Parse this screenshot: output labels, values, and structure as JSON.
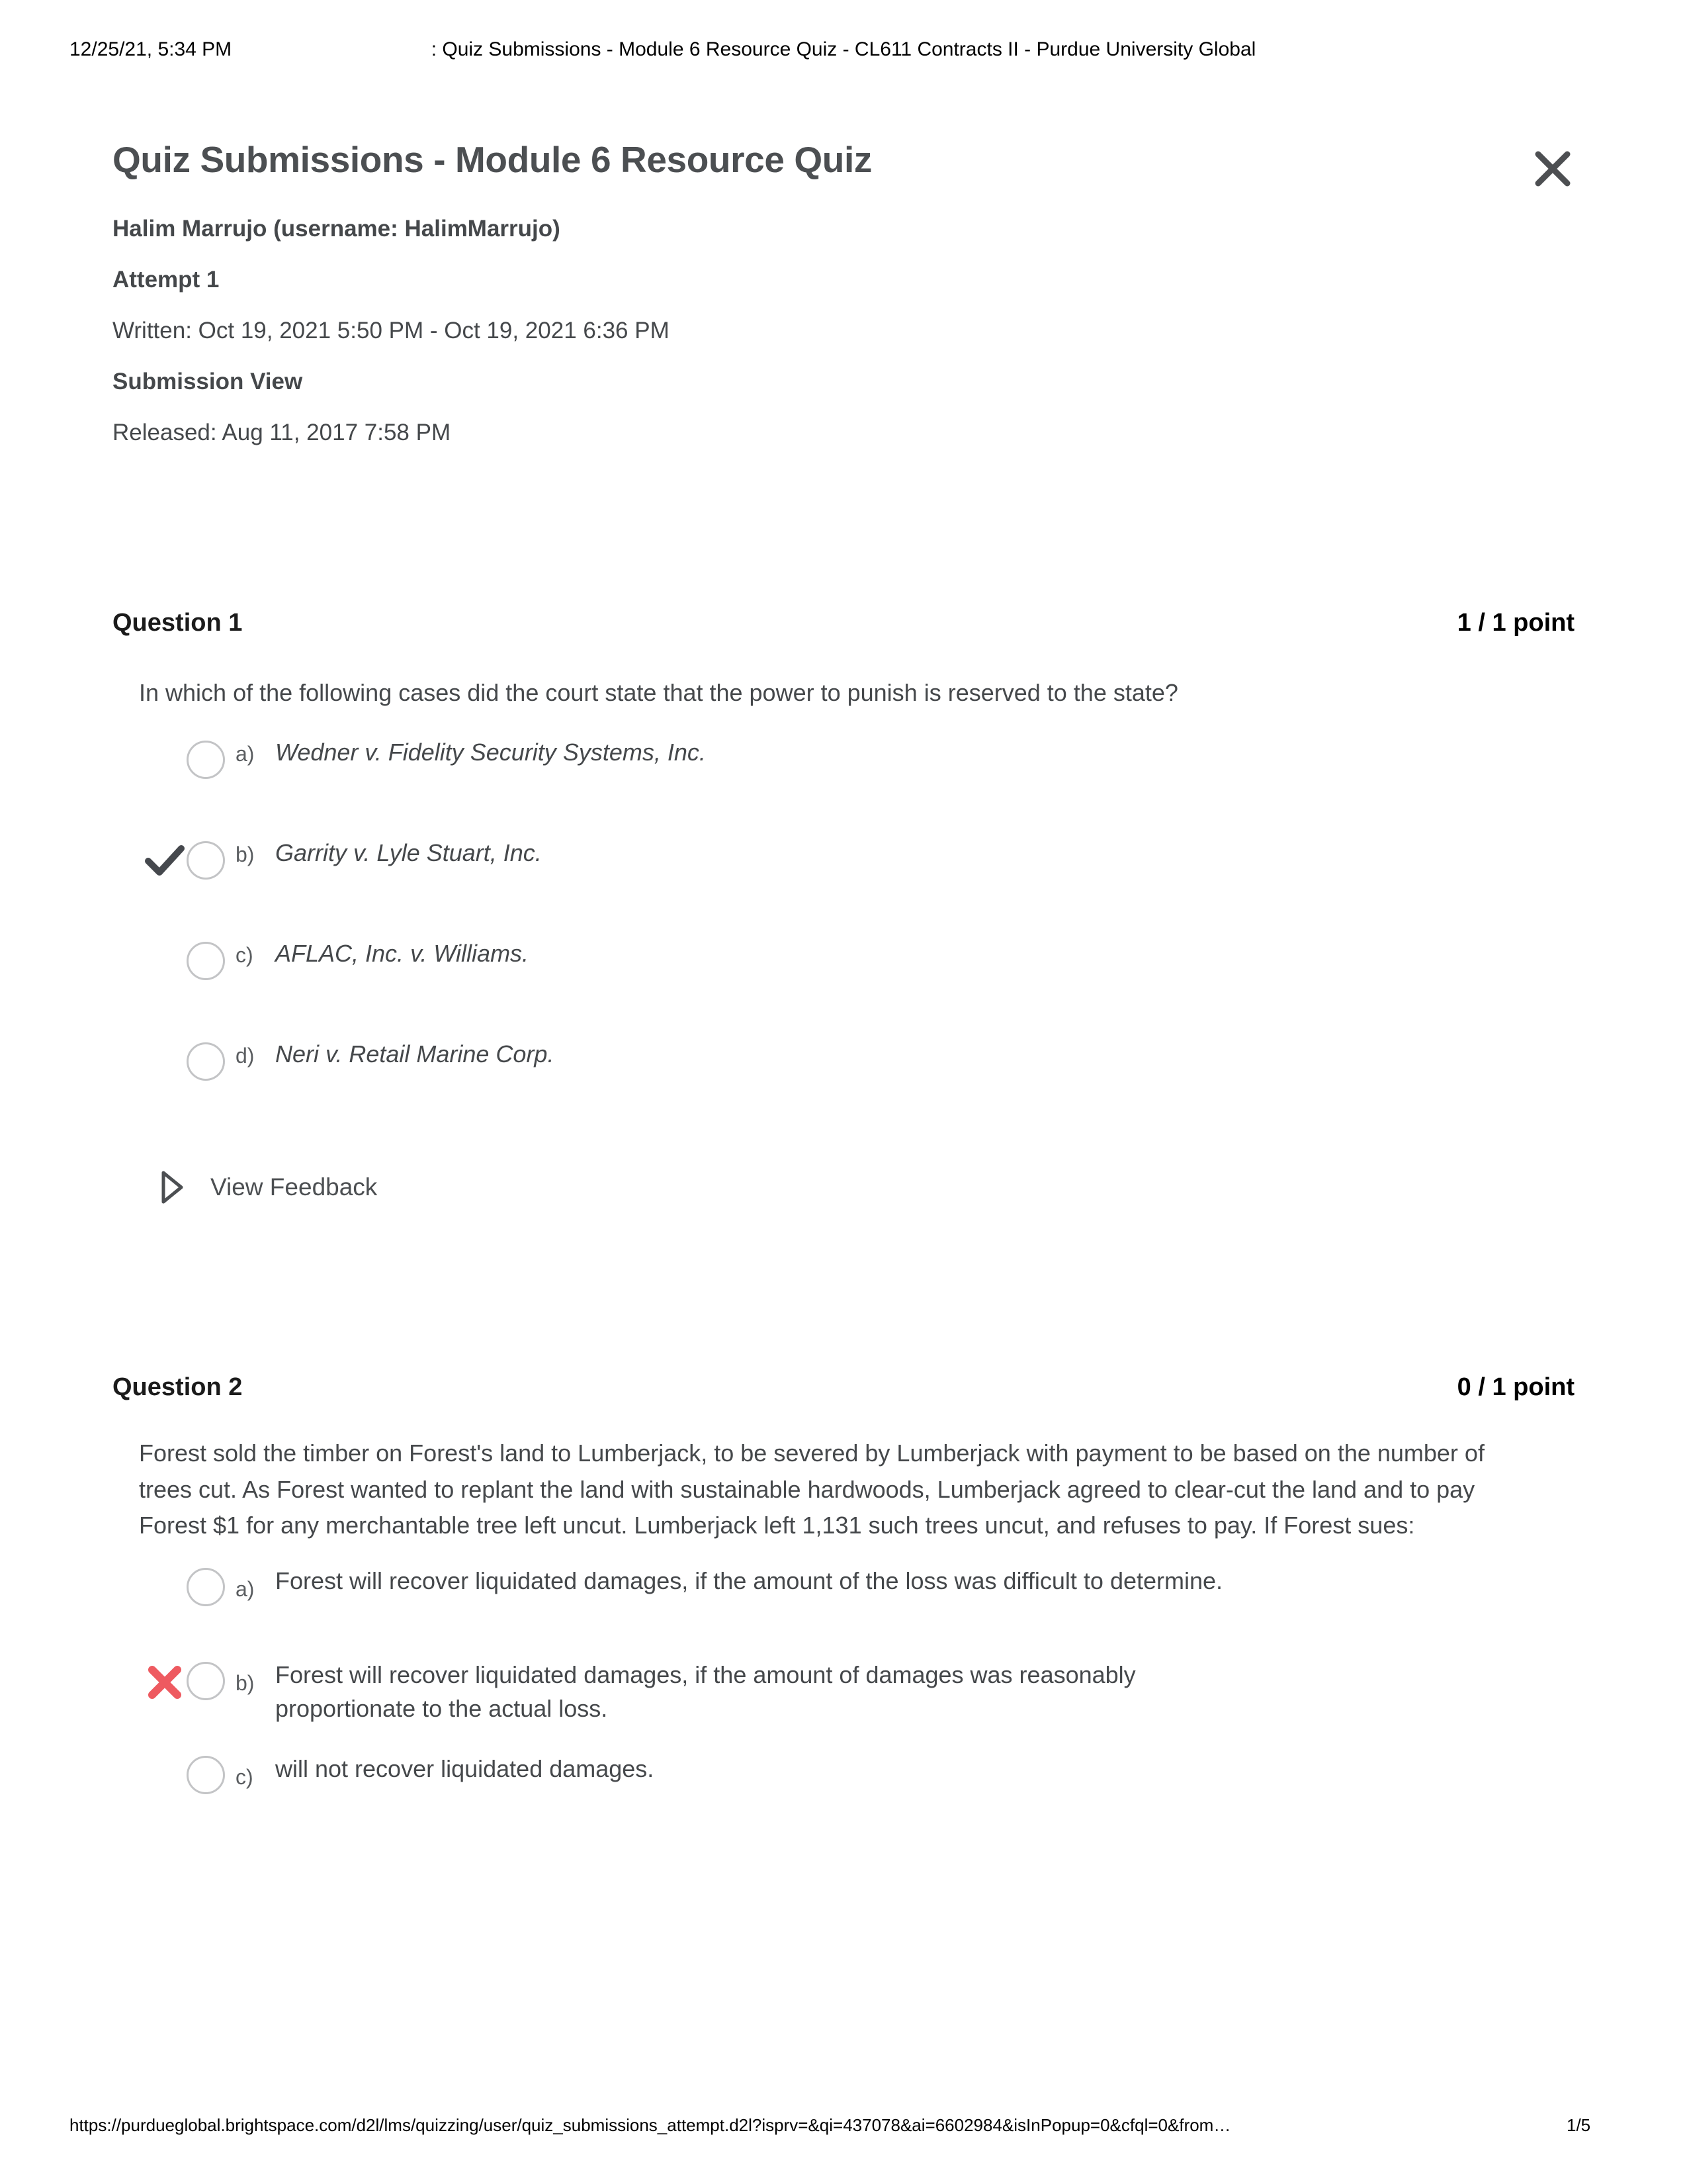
{
  "print_header": {
    "date": "12/25/21, 5:34 PM",
    "title": ": Quiz Submissions - Module 6 Resource Quiz - CL611 Contracts II - Purdue University Global"
  },
  "print_footer": {
    "url": "https://purdueglobal.brightspace.com/d2l/lms/quizzing/user/quiz_submissions_attempt.d2l?isprv=&qi=437078&ai=6602984&isInPopup=0&cfql=0&from…",
    "page": "1/5"
  },
  "header": {
    "title": "Quiz Submissions - Module 6 Resource Quiz",
    "close_icon": "close-icon"
  },
  "meta": {
    "student": "Halim Marrujo (username: HalimMarrujo)",
    "attempt": "Attempt 1",
    "written": "Written: Oct 19, 2021 5:50 PM - Oct 19, 2021 6:36 PM",
    "submission_view": "Submission View",
    "released": "Released: Aug 11, 2017 7:58 PM"
  },
  "colors": {
    "text": "#45484b",
    "heading": "#4c4f52",
    "correct_check": "#45484d",
    "incorrect_x": "#ee5a60",
    "radio_border": "#c3c4c6"
  },
  "questions": [
    {
      "number": "Question 1",
      "points": "1 / 1 point",
      "text": "In which of the following cases did the court state that the power to punish is reserved to the state?",
      "italic_options": true,
      "options": [
        {
          "letter": "a)",
          "text": "Wedner v. Fidelity Security Systems, Inc.",
          "marker": "none"
        },
        {
          "letter": "b)",
          "text": "Garrity v. Lyle Stuart, Inc.",
          "marker": "check"
        },
        {
          "letter": "c)",
          "text": "AFLAC, Inc. v. Williams.",
          "marker": "none"
        },
        {
          "letter": "d)",
          "text": "Neri v. Retail Marine Corp.",
          "marker": "none"
        }
      ],
      "feedback_label": "View Feedback",
      "feedback_icon": "caret-right-icon",
      "has_feedback": true
    },
    {
      "number": "Question 2",
      "points": "0 / 1 point",
      "text": "Forest sold the timber on Forest's land to Lumberjack, to be severed by Lumberjack with payment to be based on the number of trees cut.  As Forest wanted to replant the land with sustainable hardwoods, Lumberjack agreed to clear-cut the land and to pay Forest $1 for any merchantable tree left uncut.  Lumberjack left 1,131 such trees uncut, and refuses to pay.  If Forest sues:",
      "italic_options": false,
      "options": [
        {
          "letter": "a)",
          "text": "Forest will recover liquidated damages, if the amount of the loss was difficult to determine.",
          "marker": "none"
        },
        {
          "letter": "b)",
          "text": "Forest will recover liquidated damages, if the amount of damages was reasonably proportionate to the actual loss.",
          "marker": "cross"
        },
        {
          "letter": "c)",
          "text": "will not recover liquidated damages.",
          "marker": "none"
        }
      ],
      "has_feedback": false
    }
  ]
}
